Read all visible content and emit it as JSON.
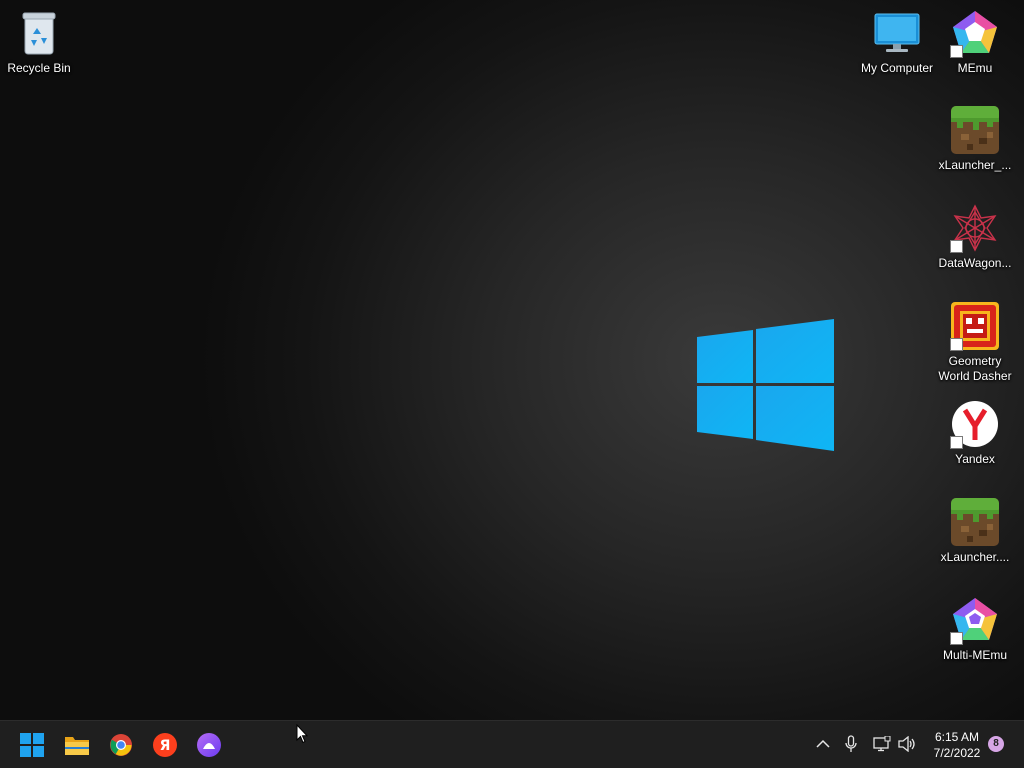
{
  "desktop": {
    "icons": [
      {
        "label": "Recycle Bin",
        "icon": "recycle-bin-icon"
      },
      {
        "label": "My Computer",
        "icon": "monitor-icon"
      },
      {
        "label": "MEmu",
        "icon": "memu-icon",
        "shortcut": true
      },
      {
        "label": "xLauncher_...",
        "icon": "minecraft-grass-block-icon"
      },
      {
        "label": "DataWagon...",
        "icon": "datawagon-icon",
        "shortcut": true
      },
      {
        "label": "Geometry World Dasher",
        "icon": "geometry-dash-icon",
        "shortcut": true
      },
      {
        "label": "Yandex",
        "icon": "yandex-browser-icon",
        "shortcut": true
      },
      {
        "label": "xLauncher....",
        "icon": "minecraft-grass-block-icon"
      },
      {
        "label": "Multi-MEmu",
        "icon": "multi-memu-icon",
        "shortcut": true
      }
    ],
    "wallpaper_logo": "windows-logo"
  },
  "taskbar": {
    "pinned": [
      {
        "name": "Start",
        "icon": "windows-start-icon"
      },
      {
        "name": "File Explorer",
        "icon": "folder-icon"
      },
      {
        "name": "Google Chrome",
        "icon": "chrome-icon"
      },
      {
        "name": "Yandex",
        "icon": "yandex-icon"
      },
      {
        "name": "Alice",
        "icon": "alice-assistant-icon"
      }
    ],
    "tray": {
      "icons": [
        "chevron-up-icon",
        "microphone-icon",
        "network-icon",
        "speaker-icon"
      ],
      "time": "6:15 AM",
      "date": "7/2/2022",
      "notification_count": "8"
    }
  },
  "colors": {
    "accent": "#00a2ed",
    "taskbar_bg": "#1f1f1f",
    "notification_badge": "#d7a6e6"
  }
}
